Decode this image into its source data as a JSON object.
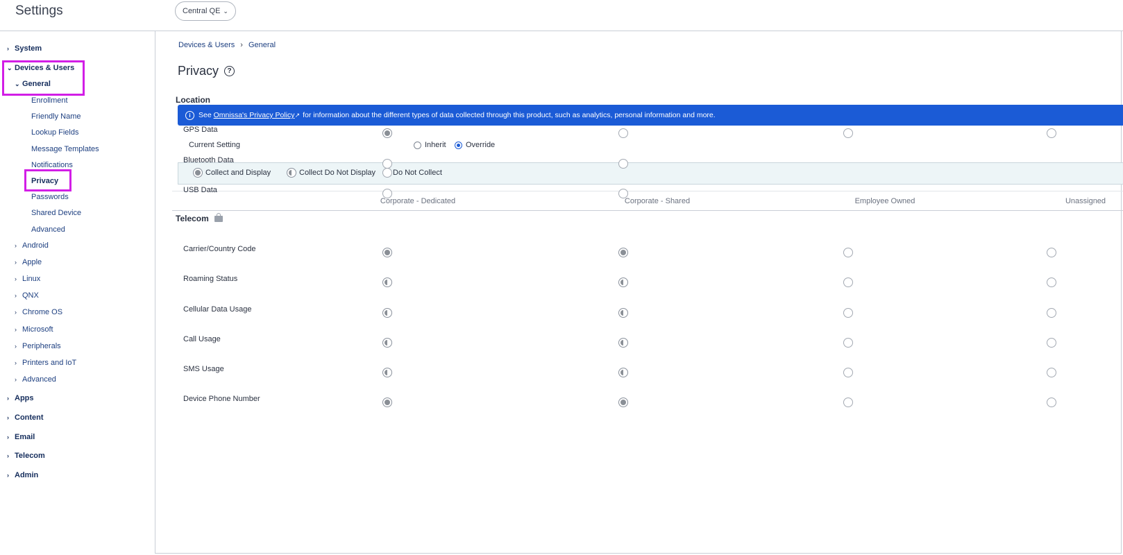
{
  "app_title": "Settings",
  "org_selector": {
    "value": "Central QE"
  },
  "sidebar": {
    "system": "System",
    "devices_users": "Devices & Users",
    "general": "General",
    "general_items": [
      "Enrollment",
      "Friendly Name",
      "Lookup Fields",
      "Message Templates",
      "Notifications",
      "Privacy",
      "Passwords",
      "Shared Device",
      "Advanced"
    ],
    "platforms": [
      "Android",
      "Apple",
      "Linux",
      "QNX",
      "Chrome OS",
      "Microsoft",
      "Peripherals",
      "Printers and IoT",
      "Advanced"
    ],
    "bottom": [
      "Apps",
      "Content",
      "Email",
      "Telecom",
      "Admin"
    ]
  },
  "breadcrumb": {
    "parent": "Devices & Users",
    "current": "General"
  },
  "page_title": "Privacy",
  "banner": {
    "prefix": "See",
    "link": "Omnissa's Privacy Policy",
    "suffix": "for information about the different types of data collected through this product, such as analytics, personal information and more."
  },
  "current_setting": {
    "label": "Current Setting",
    "options": [
      "Inherit",
      "Override"
    ],
    "selected": "Override"
  },
  "legend": [
    "Collect and Display",
    "Collect Do Not Display",
    "Do Not Collect"
  ],
  "columns": [
    "Corporate - Dedicated",
    "Corporate - Shared",
    "Employee Owned",
    "Unassigned"
  ],
  "sections": [
    {
      "title": "Location",
      "rows": [
        {
          "label": "GPS Data",
          "values": [
            "collect_display",
            "do_not_collect",
            "do_not_collect",
            "do_not_collect"
          ]
        },
        {
          "label": "Bluetooth Data",
          "values": [
            "do_not_collect",
            "do_not_collect",
            null,
            null
          ]
        },
        {
          "label": "USB Data",
          "values": [
            "do_not_collect",
            "do_not_collect",
            null,
            null
          ]
        }
      ]
    },
    {
      "title": "Telecom",
      "icon": "lock-icon",
      "rows": [
        {
          "label": "Carrier/Country Code",
          "values": [
            "collect_display",
            "collect_display",
            "do_not_collect",
            "do_not_collect"
          ]
        },
        {
          "label": "Roaming Status",
          "values": [
            "collect_not_display",
            "collect_not_display",
            "do_not_collect",
            "do_not_collect"
          ]
        },
        {
          "label": "Cellular Data Usage",
          "values": [
            "collect_not_display",
            "collect_not_display",
            "do_not_collect",
            "do_not_collect"
          ]
        },
        {
          "label": "Call Usage",
          "values": [
            "collect_not_display",
            "collect_not_display",
            "do_not_collect",
            "do_not_collect"
          ]
        },
        {
          "label": "SMS Usage",
          "values": [
            "collect_not_display",
            "collect_not_display",
            "do_not_collect",
            "do_not_collect"
          ]
        },
        {
          "label": "Device Phone Number",
          "values": [
            "collect_display",
            "collect_display",
            "do_not_collect",
            "do_not_collect"
          ]
        }
      ]
    }
  ],
  "colors": {
    "accent": "#1b5bd6",
    "highlight": "#d21ee6",
    "nav_text": "#1d3f80"
  }
}
